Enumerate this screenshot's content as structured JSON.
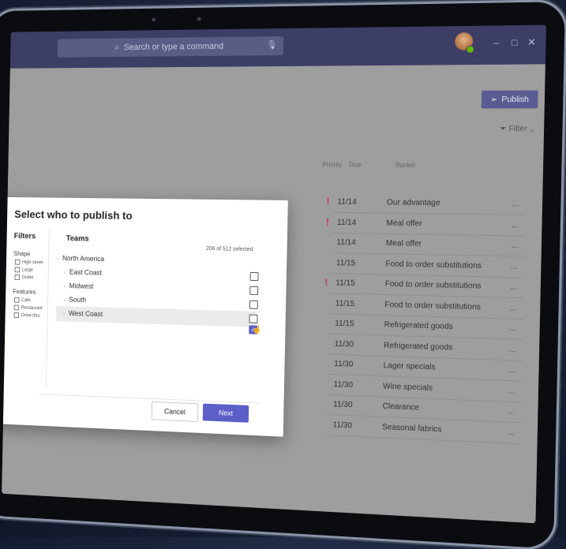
{
  "search": {
    "placeholder": "Search or type a command",
    "icon": "search-icon",
    "mic_icon": "mic-icon"
  },
  "window_controls": {
    "minimize": "–",
    "maximize": "□",
    "close": "✕"
  },
  "toolbar": {
    "publish_label": "Publish",
    "publish_icon": "send-icon",
    "filter_label": "Filter",
    "filter_icon": "funnel-icon"
  },
  "table": {
    "headers": {
      "priority": "Priority",
      "due": "Due",
      "bucket": "Bucket"
    },
    "rows": [
      {
        "priority": "!",
        "due": "11/14",
        "bucket": "Our advantage",
        "more": "..."
      },
      {
        "priority": "!",
        "due": "11/14",
        "bucket": "Meal offer",
        "more": "..."
      },
      {
        "priority": "",
        "due": "11/14",
        "bucket": "Meal offer",
        "more": "..."
      },
      {
        "priority": "",
        "due": "11/15",
        "bucket": "Food to order substitutions",
        "more": "..."
      },
      {
        "priority": "!",
        "due": "11/15",
        "bucket": "Food to order substitutions",
        "more": "..."
      },
      {
        "priority": "",
        "due": "11/15",
        "bucket": "Food to order substitutions",
        "more": "..."
      },
      {
        "priority": "",
        "due": "11/15",
        "bucket": "Refrigerated goods",
        "more": "..."
      },
      {
        "priority": "",
        "due": "11/30",
        "bucket": "Refrigerated goods",
        "more": "..."
      },
      {
        "priority": "",
        "due": "11/30",
        "bucket": "Lager specials",
        "more": "..."
      },
      {
        "priority": "",
        "due": "11/30",
        "bucket": "Wine specials",
        "more": "..."
      },
      {
        "priority": "",
        "due": "11/30",
        "bucket": "Clearance",
        "more": "..."
      },
      {
        "priority": "",
        "due": "11/30",
        "bucket": "Seasonal fabrics",
        "more": "..."
      }
    ]
  },
  "dialog": {
    "title": "Select who to publish to",
    "filters_title": "Filters",
    "filter_groups": [
      {
        "label": "Shape",
        "options": [
          "High street",
          "Large",
          "Outlet"
        ]
      },
      {
        "label": "Features",
        "options": [
          "Cafe",
          "Restaurant",
          "Drive-thru"
        ]
      }
    ],
    "teams_title": "Teams",
    "selected_count": "206 of 512 selected",
    "teams": [
      {
        "label": "North America",
        "checked": false
      },
      {
        "label": "East Coast",
        "checked": false
      },
      {
        "label": "Midwest",
        "checked": false
      },
      {
        "label": "South",
        "checked": false
      },
      {
        "label": "West Coast",
        "checked": true
      }
    ],
    "cancel_label": "Cancel",
    "next_label": "Next"
  },
  "colors": {
    "brand": "#5b5fc7",
    "titlebar": "#3d3e66",
    "priority": "#c4314b"
  }
}
